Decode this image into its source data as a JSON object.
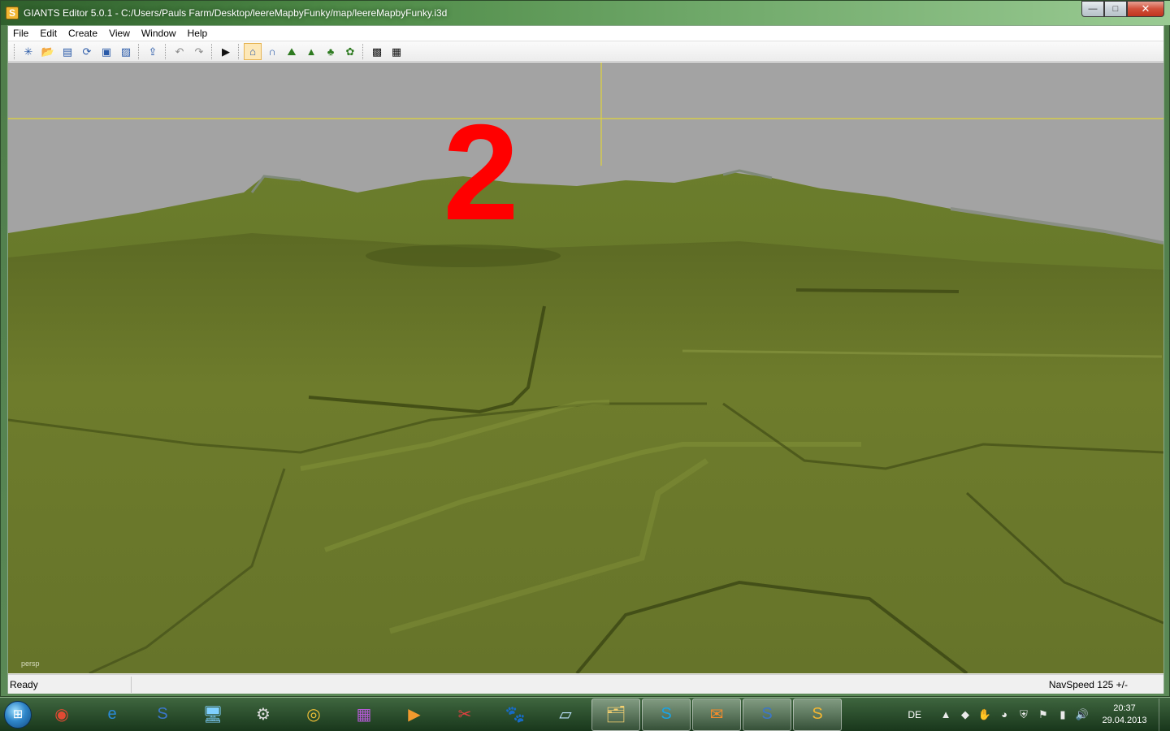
{
  "window": {
    "app_icon_glyph": "S",
    "title": "GIANTS Editor 5.0.1 - C:/Users/Pauls Farm/Desktop/leereMapbyFunky/map/leereMapbyFunky.i3d",
    "controls": {
      "minimize": "—",
      "maximize": "□",
      "close": "✕"
    }
  },
  "menu": [
    "File",
    "Edit",
    "Create",
    "View",
    "Window",
    "Help"
  ],
  "toolbar": {
    "groups": [
      [
        {
          "icon": "new-file-icon",
          "glyph": "✳"
        },
        {
          "icon": "open-file-icon",
          "glyph": "📂"
        },
        {
          "icon": "document-icon",
          "glyph": "▤"
        },
        {
          "icon": "refresh-icon",
          "glyph": "⟳"
        },
        {
          "icon": "save-icon",
          "glyph": "▣"
        },
        {
          "icon": "save-as-icon",
          "glyph": "▨"
        }
      ],
      [
        {
          "icon": "import-icon",
          "glyph": "⇪"
        }
      ],
      [
        {
          "icon": "undo-icon",
          "glyph": "↶"
        },
        {
          "icon": "redo-icon",
          "glyph": "↷"
        }
      ],
      [
        {
          "icon": "play-icon",
          "glyph": "▶"
        }
      ],
      [
        {
          "icon": "camera-home-icon",
          "glyph": "⌂",
          "active": true
        },
        {
          "icon": "transform-icon",
          "glyph": "∩"
        },
        {
          "icon": "terrain-sculpt-icon",
          "glyph": "⛰"
        },
        {
          "icon": "terrain-paint-icon",
          "glyph": "▲"
        },
        {
          "icon": "foliage-icon",
          "glyph": "♣"
        },
        {
          "icon": "grass-icon",
          "glyph": "✿"
        }
      ],
      [
        {
          "icon": "texture-paint-icon",
          "glyph": "▩"
        },
        {
          "icon": "texture-erase-icon",
          "glyph": "▦"
        }
      ]
    ]
  },
  "viewport": {
    "overlay_number": "2",
    "camera_label": "persp",
    "sky_color": "#a3a3a3",
    "terrain_color": "#6b7a2a",
    "gizmo_color": "#e0d43a",
    "overlay_color": "#ff0000"
  },
  "statusbar": {
    "left": "Ready",
    "right": "NavSpeed 125 +/-"
  },
  "taskbar": {
    "start_glyph": "⊞",
    "apps": [
      {
        "icon": "chrome-icon",
        "glyph": "◉",
        "color": "#e24a33",
        "open": false
      },
      {
        "icon": "internet-explorer-icon",
        "glyph": "e",
        "color": "#2a8ad8",
        "open": false
      },
      {
        "icon": "giants-editor-icon",
        "glyph": "S",
        "color": "#3b76c9",
        "open": false
      },
      {
        "icon": "computer-icon",
        "glyph": "🖥",
        "color": "#7fd0ff",
        "open": false
      },
      {
        "icon": "settings-gear-icon",
        "glyph": "⚙",
        "color": "#dddddd",
        "open": false
      },
      {
        "icon": "disc-icon",
        "glyph": "◎",
        "color": "#f2c037",
        "open": false
      },
      {
        "icon": "winrar-icon",
        "glyph": "▦",
        "color": "#b55ad6",
        "open": false
      },
      {
        "icon": "media-player-icon",
        "glyph": "▶",
        "color": "#f29a2e",
        "open": false
      },
      {
        "icon": "snipping-tool-icon",
        "glyph": "✂",
        "color": "#e04040",
        "open": false
      },
      {
        "icon": "gimp-icon",
        "glyph": "🐾",
        "color": "#cccccc",
        "open": false
      },
      {
        "icon": "notepad-icon",
        "glyph": "▱",
        "color": "#bfe3ff",
        "open": false
      },
      {
        "icon": "file-explorer-icon",
        "glyph": "🗂",
        "color": "#f4d06f",
        "open": true
      },
      {
        "icon": "skype-icon",
        "glyph": "S",
        "color": "#19a3e6",
        "open": true
      },
      {
        "icon": "mail-icon",
        "glyph": "✉",
        "color": "#f58b2a",
        "open": true
      },
      {
        "icon": "giants-editor-icon",
        "glyph": "S",
        "color": "#3b76c9",
        "open": true
      },
      {
        "icon": "giants-editor-active-icon",
        "glyph": "S",
        "color": "#f2b632",
        "open": true
      }
    ],
    "tray": {
      "language": "DE",
      "icons": [
        {
          "icon": "show-hidden-icon",
          "glyph": "▲"
        },
        {
          "icon": "tray-app-green-icon",
          "glyph": "◆"
        },
        {
          "icon": "tray-hand-icon",
          "glyph": "✋"
        },
        {
          "icon": "tray-orange-icon",
          "glyph": "◕"
        },
        {
          "icon": "antivirus-icon",
          "glyph": "⛨"
        },
        {
          "icon": "action-center-flag-icon",
          "glyph": "⚑"
        },
        {
          "icon": "network-signal-icon",
          "glyph": "▮"
        },
        {
          "icon": "volume-icon",
          "glyph": "🔊"
        }
      ],
      "time": "20:37",
      "date": "29.04.2013"
    }
  }
}
